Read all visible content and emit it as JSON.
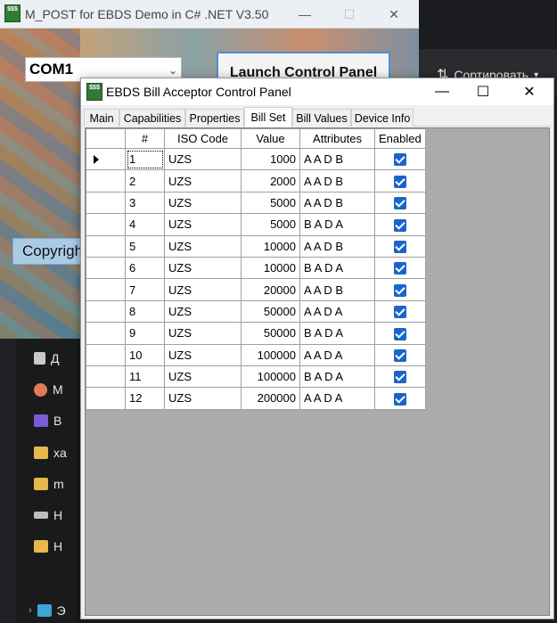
{
  "main_window": {
    "title": "M_POST for EBDS Demo in C# .NET V3.50",
    "icon_text": "$$$",
    "com_port": "COM1",
    "launch_button": "Launch Control Panel",
    "copyright_button": "Copyrigh"
  },
  "explorer": {
    "sort_label": "Сортировать",
    "sidebar_items": [
      {
        "label": "Д",
        "icon": "document-icon"
      },
      {
        "label": "M",
        "icon": "music-icon"
      },
      {
        "label": "B",
        "icon": "video-icon"
      },
      {
        "label": "xa",
        "icon": "folder-icon"
      },
      {
        "label": "m",
        "icon": "folder-icon"
      },
      {
        "label": "H",
        "icon": "drive-icon"
      },
      {
        "label": "H",
        "icon": "folder-icon"
      },
      {
        "label": "Э",
        "icon": "computer-icon"
      }
    ]
  },
  "control_panel": {
    "title": "EBDS Bill Acceptor Control Panel",
    "icon_text": "$$$",
    "tabs": [
      "Main",
      "Capabilities",
      "Properties",
      "Bill Set",
      "Bill Values",
      "Device Info"
    ],
    "active_tab": "Bill Set",
    "columns": [
      "#",
      "ISO Code",
      "Value",
      "Attributes",
      "Enabled"
    ],
    "rows": [
      {
        "num": "1",
        "iso": "UZS",
        "value": "1000",
        "attr": "A A D B",
        "enabled": true
      },
      {
        "num": "2",
        "iso": "UZS",
        "value": "2000",
        "attr": "A A D B",
        "enabled": true
      },
      {
        "num": "3",
        "iso": "UZS",
        "value": "5000",
        "attr": "A A D B",
        "enabled": true
      },
      {
        "num": "4",
        "iso": "UZS",
        "value": "5000",
        "attr": "B A D A",
        "enabled": true
      },
      {
        "num": "5",
        "iso": "UZS",
        "value": "10000",
        "attr": "A A D B",
        "enabled": true
      },
      {
        "num": "6",
        "iso": "UZS",
        "value": "10000",
        "attr": "B A D A",
        "enabled": true
      },
      {
        "num": "7",
        "iso": "UZS",
        "value": "20000",
        "attr": "A A D B",
        "enabled": true
      },
      {
        "num": "8",
        "iso": "UZS",
        "value": "50000",
        "attr": "A A D A",
        "enabled": true
      },
      {
        "num": "9",
        "iso": "UZS",
        "value": "50000",
        "attr": "B A D A",
        "enabled": true
      },
      {
        "num": "10",
        "iso": "UZS",
        "value": "100000",
        "attr": "A A D A",
        "enabled": true
      },
      {
        "num": "11",
        "iso": "UZS",
        "value": "100000",
        "attr": "B A D A",
        "enabled": true
      },
      {
        "num": "12",
        "iso": "UZS",
        "value": "200000",
        "attr": "A A D A",
        "enabled": true
      }
    ],
    "selected_row": 0
  },
  "colors": {
    "accent": "#1a66c8",
    "grid_background": "#ababab",
    "launch_border": "#4a90d9"
  }
}
